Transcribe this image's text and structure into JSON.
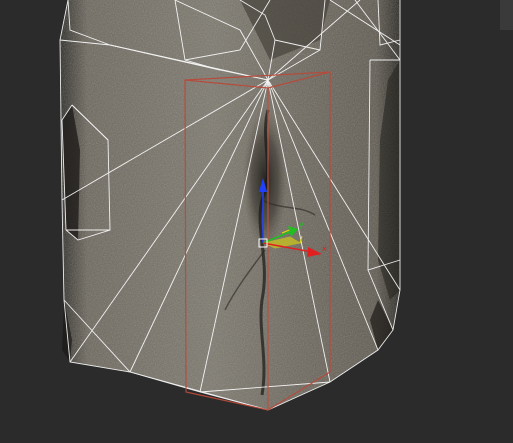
{
  "viewport": {
    "background_color": "#2b2b2b"
  },
  "scene": {
    "object": "textured-stone-column",
    "texture_colors": [
      "#6f6a5f",
      "#5b564c",
      "#7c776b",
      "#4a463e"
    ],
    "wireframe_color": "#ffffff",
    "selection_color": "#b84a3a"
  },
  "gizmo": {
    "type": "move-transform-gizmo",
    "x_axis": {
      "label": "x",
      "color": "#e02020"
    },
    "y_axis": {
      "label": "y",
      "color": "#20c020"
    },
    "z_axis": {
      "label": "",
      "color": "#2040ff"
    },
    "plane_color": "#e8e000"
  }
}
